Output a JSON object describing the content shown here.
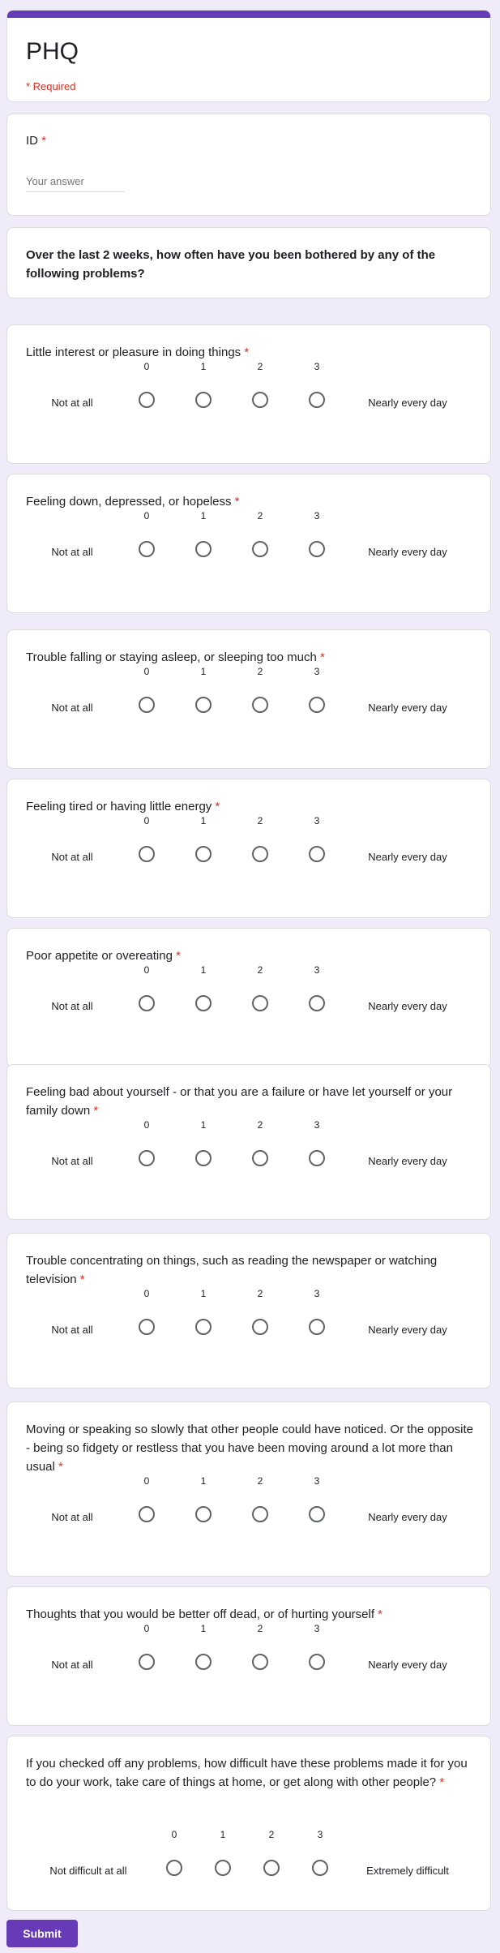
{
  "form": {
    "title": "PHQ",
    "required_note": "* Required",
    "submit_label": "Submit"
  },
  "id_field": {
    "label": "ID",
    "required_mark": "*",
    "placeholder": "Your answer"
  },
  "instructions": "Over the last 2 weeks, how often have you been bothered by any of the following problems?",
  "scale": {
    "values": [
      "0",
      "1",
      "2",
      "3"
    ],
    "low_label": "Not at all",
    "high_label": "Nearly every day"
  },
  "questions": [
    {
      "text": "Little interest or pleasure in doing things",
      "required_mark": "*"
    },
    {
      "text": "Feeling down, depressed, or hopeless",
      "required_mark": "*"
    },
    {
      "text": "Trouble falling or staying asleep, or sleeping too much",
      "required_mark": "*"
    },
    {
      "text": "Feeling tired or having little energy",
      "required_mark": "*"
    },
    {
      "text": "Poor appetite or overeating",
      "required_mark": "*"
    },
    {
      "text": "Feeling bad about yourself - or that you are a failure or have let yourself or your family down",
      "required_mark": "*"
    },
    {
      "text": "Trouble concentrating on things, such as reading the newspaper or watching television",
      "required_mark": "*"
    },
    {
      "text": "Moving or speaking so slowly that other people could have noticed. Or the opposite - being so fidgety or restless that you have been moving around a lot more than usual",
      "required_mark": "*"
    },
    {
      "text": "Thoughts that you would be better off dead, or of hurting yourself",
      "required_mark": "*"
    }
  ],
  "difficulty_question": {
    "text": "If you checked off any problems, how difficult have these problems made it for you to do your work, take care of things at home, or get along with other people?",
    "required_mark": "*",
    "values": [
      "0",
      "1",
      "2",
      "3"
    ],
    "low_label": "Not difficult at all",
    "high_label": "Extremely difficult"
  }
}
